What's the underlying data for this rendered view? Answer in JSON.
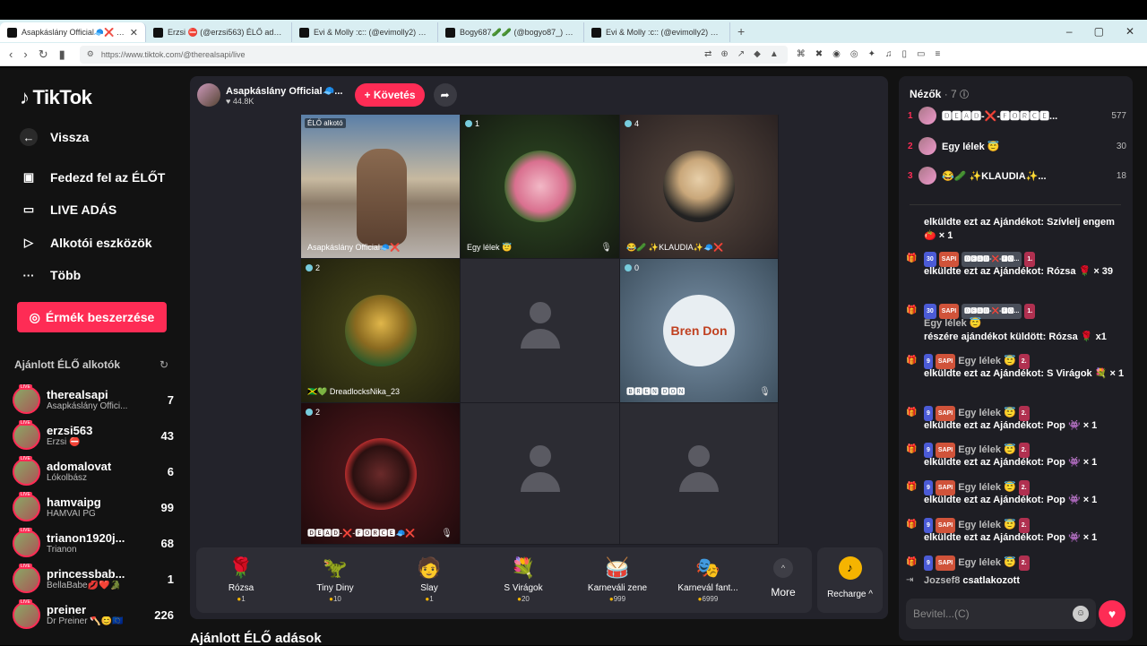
{
  "browser": {
    "tabs": [
      {
        "title": "Asapkáslány Official🧢❌ (@",
        "active": true
      },
      {
        "title": "Erzsi ⛔ (@erzsi563) ÉLŐ adásba",
        "active": false
      },
      {
        "title": "Evi & Molly :с:: (@evimolly2) ÉLŐ adá",
        "active": false
      },
      {
        "title": "Bogy687🥒🥒 (@bogyo87_) ÉLŐ a",
        "active": false
      },
      {
        "title": "Evi & Molly :с:: (@evimolly2) ÉLŐ adás",
        "active": false
      }
    ],
    "url": "https://www.tiktok.com/@therealsapi/live"
  },
  "sidebar": {
    "logo": "TikTok",
    "back": "Vissza",
    "nav": [
      "Fedezd fel az ÉLŐT",
      "LIVE ADÁS",
      "Alkotói eszközök",
      "Több"
    ],
    "coins_button": "Érmék beszerzése",
    "suggested_title": "Ajánlott ÉLŐ alkotók",
    "live_tag": "LIVE",
    "creators": [
      {
        "name": "therealsapi",
        "sub": "Asapkáslány Offici...",
        "count": "7"
      },
      {
        "name": "erzsi563",
        "sub": "Erzsi ⛔",
        "count": "43"
      },
      {
        "name": "adomalovat",
        "sub": "Lókolbász",
        "count": "6"
      },
      {
        "name": "hamvaipg",
        "sub": "HAMVAI PG",
        "count": "99"
      },
      {
        "name": "trianon1920j...",
        "sub": "Trianon",
        "count": "68"
      },
      {
        "name": "princessbab...",
        "sub": "BellaBabe💋❤️🐊",
        "count": "1"
      },
      {
        "name": "preiner",
        "sub": "Dr Preiner 🪓😊🇪🇺",
        "count": "226"
      }
    ]
  },
  "host": {
    "name": "Asapkáslány Official🧢...",
    "likes": "♥ 44.8K",
    "follow": "+ Követés"
  },
  "grid": {
    "creator_label": "ÉLŐ alkotó",
    "host_name": "Asapkáslány Official🧢❌",
    "cells": [
      {
        "badge": "1",
        "name": "Egy lélek 😇"
      },
      {
        "badge": "4",
        "name": "😂🥒 ✨KLAUDIA✨🧢❌"
      },
      {
        "badge": "2",
        "name": "🇯🇲💚 DreadlocksNika_23"
      },
      {
        "badge": "0",
        "name": "🅱🆁🅴🅽 🅳🅾🅽"
      },
      {
        "badge": "2",
        "name": "🅳🅴🅰🅳-❌-🅵🅾🆁🅲🅴🧢❌"
      }
    ],
    "bren_text": "Bren Don"
  },
  "gifts": [
    {
      "icon": "🌹",
      "label": "Rózsa",
      "price": "1"
    },
    {
      "icon": "🦖",
      "label": "Tiny Diny",
      "price": "10"
    },
    {
      "icon": "🧑",
      "label": "Slay",
      "price": "1"
    },
    {
      "icon": "💐",
      "label": "S Virágok",
      "price": "20"
    },
    {
      "icon": "🥁",
      "label": "Karneváli zene",
      "price": "999"
    },
    {
      "icon": "🎭",
      "label": "Karnevál fant...",
      "price": "6999"
    }
  ],
  "more_label": "More",
  "recharge_label": "Recharge ^",
  "below_title": "Ajánlott ÉLŐ adások",
  "chat": {
    "viewers_title": "Nézők",
    "viewers_count": "· 7",
    "viewers": [
      {
        "rank": "1",
        "name": "🅳🅴🅰🅳-❌-🅵🅾🆁🅲🅴...",
        "score": "577"
      },
      {
        "rank": "2",
        "name": "Egy lélek 😇",
        "score": "30"
      },
      {
        "rank": "3",
        "name": "😂🥒 ✨KLAUDIA✨...",
        "score": "18"
      }
    ],
    "messages": [
      {
        "tags": [],
        "user": "",
        "text": "elküldte ezt az Ajándékot: Szívlelj engem 🍅 × 1"
      },
      {
        "tags": [
          "30",
          "SAPI",
          "🅳🅴🅰🅳-❌-🅵🅾...",
          "1."
        ],
        "user": "",
        "text": "elküldte ezt az Ajándékot: Rózsa 🌹 × 39"
      },
      {
        "tags": [
          "30",
          "SAPI",
          "🅳🅴🅰🅳-❌-🅵🅾...",
          "1."
        ],
        "user": "Egy lélek 😇",
        "text": "részére ajándékot küldött: Rózsa 🌹 x1"
      },
      {
        "tags": [
          "9",
          "SAPI"
        ],
        "user": "Egy lélek 😇",
        "badge": "2.",
        "text": "elküldte ezt az Ajándékot: S Virágok 💐 × 1"
      },
      {
        "tags": [
          "9",
          "SAPI"
        ],
        "user": "Egy lélek 😇",
        "badge": "2.",
        "text": "elküldte ezt az Ajándékot: Pop 👾 × 1"
      },
      {
        "tags": [
          "9",
          "SAPI"
        ],
        "user": "Egy lélek 😇",
        "badge": "2.",
        "text": "elküldte ezt az Ajándékot: Pop 👾 × 1"
      },
      {
        "tags": [
          "9",
          "SAPI"
        ],
        "user": "Egy lélek 😇",
        "badge": "2.",
        "text": "elküldte ezt az Ajándékot: Pop 👾 × 1"
      },
      {
        "tags": [
          "9",
          "SAPI"
        ],
        "user": "Egy lélek 😇",
        "badge": "2.",
        "text": "elküldte ezt az Ajándékot: Pop 👾 × 1"
      },
      {
        "tags": [
          "9",
          "SAPI"
        ],
        "user": "Egy lélek 😇",
        "badge": "2.",
        "text": ""
      }
    ],
    "joined_user": "Jozsef8",
    "joined_text": "csatlakozott",
    "input_placeholder": "Bevitel...(C)"
  }
}
